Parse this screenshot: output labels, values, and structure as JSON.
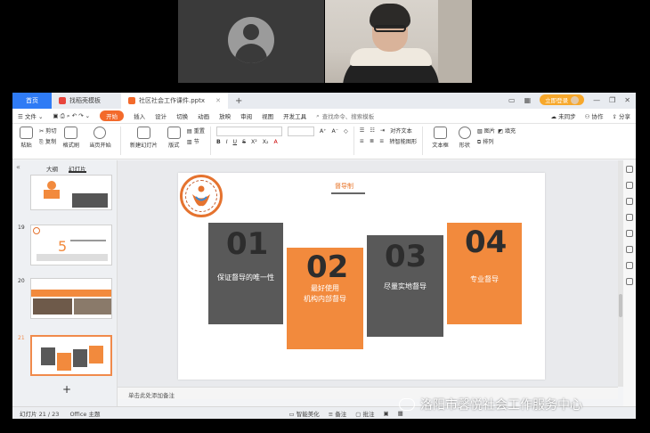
{
  "tabs": {
    "home": "首页",
    "template": "找稻壳模板",
    "doc": "社区社会工作课件.pptx",
    "plus": "+"
  },
  "window": {
    "login": "立即登录"
  },
  "menu": {
    "file": "文件",
    "start": "开始",
    "insert": "插入",
    "design": "设计",
    "switch": "切换",
    "animation": "动画",
    "show": "放映",
    "review": "审阅",
    "view": "视图",
    "dev": "开发工具",
    "search": "查找命令、搜索模板",
    "sync": "未同步",
    "collab": "协作",
    "share": "分享"
  },
  "ribbon": {
    "cut": "剪切",
    "copy": "复制",
    "format_painter": "格式刷",
    "paste": "粘贴",
    "play_from_current": "当页开始",
    "new_slide": "新建幻灯片",
    "layout": "版式",
    "reset": "重置",
    "section": "节",
    "align_text": "对齐文本",
    "convert_smartart": "转智能图形",
    "textbox": "文本框",
    "shape": "形状",
    "arrange": "排列",
    "picture": "图片",
    "fill": "填充"
  },
  "left_panel": {
    "tab_outline": "大纲",
    "tab_slides": "幻灯片",
    "thumbs": [
      {
        "num": ""
      },
      {
        "num": "19"
      },
      {
        "num": "20"
      },
      {
        "num": "21"
      }
    ],
    "add": "+"
  },
  "slide": {
    "title": "督导制",
    "boxes": [
      {
        "num": "01",
        "label": "保证督导的唯一性"
      },
      {
        "num": "02",
        "label": "最好使用\n机构内部督导"
      },
      {
        "num": "03",
        "label": "尽量实地督导"
      },
      {
        "num": "04",
        "label": "专业督导"
      }
    ],
    "colors": {
      "dark": "#595959",
      "orange": "#f28a3d"
    }
  },
  "notes": {
    "placeholder": "单击此处添加备注"
  },
  "status": {
    "slide_count": "幻灯片 21 / 23",
    "theme": "Office 主题",
    "beautify": "智能美化",
    "notes": "备注",
    "comments": "批注"
  },
  "watermark": {
    "text": "洛阳市馨悦社会工作服务中心"
  }
}
